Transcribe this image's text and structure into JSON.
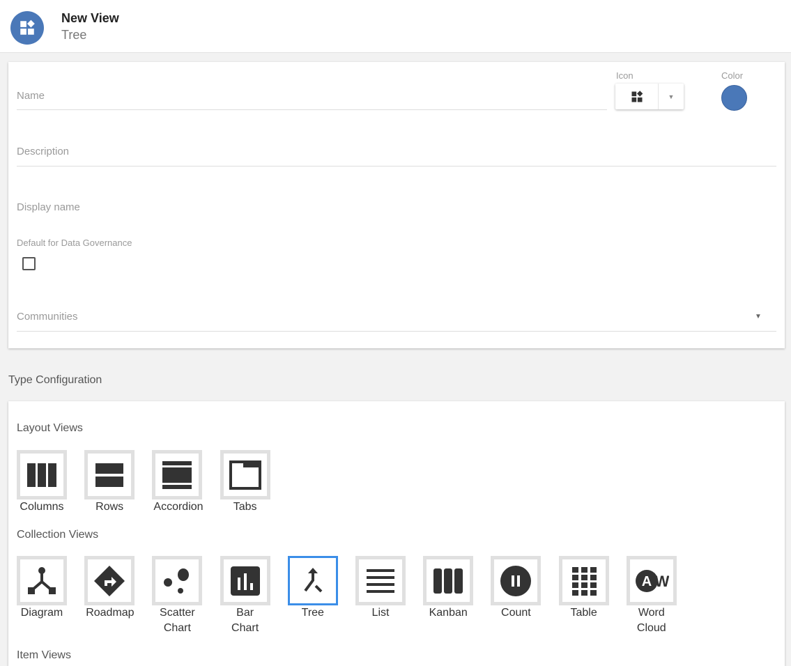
{
  "header": {
    "title": "New View",
    "subtitle": "Tree"
  },
  "form": {
    "name_label": "Name",
    "icon_label": "Icon",
    "color_label": "Color",
    "color_value": "#4a78b8",
    "description_label": "Description",
    "display_name_label": "Display name",
    "default_label": "Default for Data Governance",
    "default_checked": false,
    "communities_label": "Communities"
  },
  "type_config": {
    "title": "Type Configuration",
    "layout_title": "Layout Views",
    "layout": [
      {
        "label": "Columns"
      },
      {
        "label": "Rows"
      },
      {
        "label": "Accordion"
      },
      {
        "label": "Tabs"
      }
    ],
    "collection_title": "Collection Views",
    "collection": [
      {
        "label": "Diagram"
      },
      {
        "label": "Roadmap"
      },
      {
        "label": "Scatter Chart"
      },
      {
        "label": "Bar Chart"
      },
      {
        "label": "Tree",
        "selected": true
      },
      {
        "label": "List"
      },
      {
        "label": "Kanban"
      },
      {
        "label": "Count"
      },
      {
        "label": "Table"
      },
      {
        "label": "Word Cloud"
      }
    ],
    "item_title": "Item Views"
  },
  "colors": {
    "accent": "#4a78b8",
    "selected": "#3b8ee8"
  }
}
